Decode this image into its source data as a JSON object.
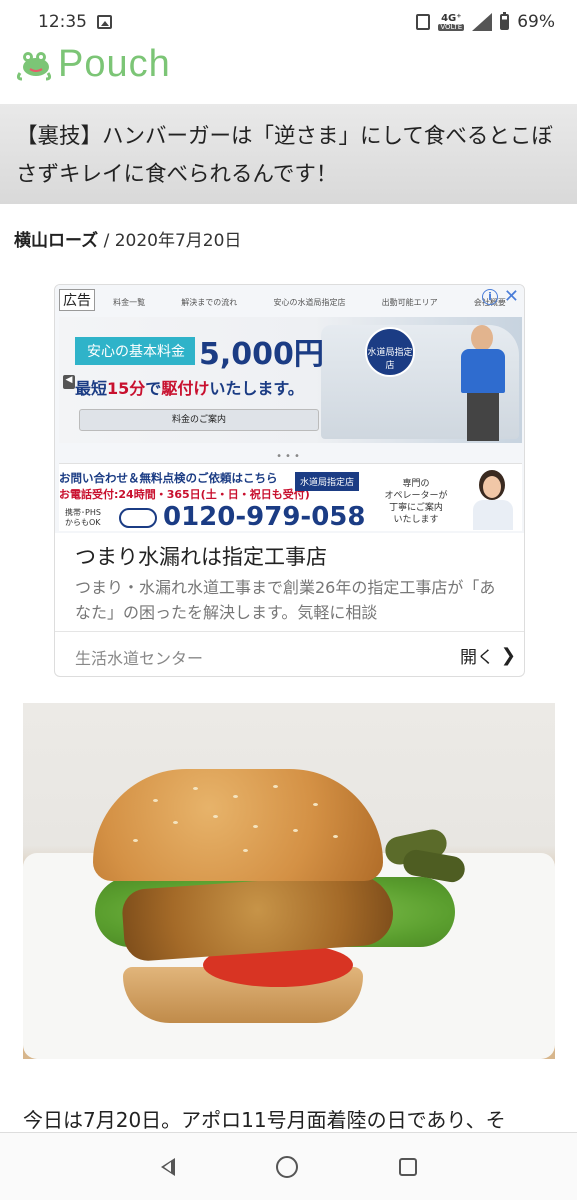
{
  "status_bar": {
    "time": "12:35",
    "network": "4G⁺",
    "volte": "VOLTE",
    "battery": "69%"
  },
  "site": {
    "logo_text": "Pouch",
    "brand_color": "#7cc576"
  },
  "article": {
    "title": "【裏技】ハンバーガーは「逆さま」にして食べるとこぼさずキレイに食べられるんです！",
    "author": "横山ローズ",
    "separator": "/",
    "date": "2020年7月20日",
    "body_first_line": "今日は7月20日。アポロ11号月面着陸の日であり、そ"
  },
  "ad": {
    "badge": "広告",
    "info": "i",
    "close": "✕",
    "nav_items": [
      "料金一覧",
      "解決までの流れ",
      "安心の水道局指定店",
      "出動可能エリア",
      "会社概要"
    ],
    "hero": {
      "basic_fee_label": "安心の基本料金",
      "price": "5,000円",
      "arrival_prefix": "最短",
      "arrival_minutes": "15分",
      "arrival_mid": "で",
      "arrival_highlight": "駆付け",
      "arrival_suffix": "いたします。",
      "button": "料金のご案内",
      "badge": "水道局指定店"
    },
    "dots": "•••",
    "contact": {
      "line1": "お問い合わせ＆無料点検のご依頼はこちら",
      "line2": "お電話受付:24時間・365日(土・日・祝日も受付)",
      "tag": "水道局指定店",
      "mobile_note_1": "携帯･PHS",
      "mobile_note_2": "からもOK",
      "phone": "0120-979-058",
      "bubble_1": "専門の",
      "bubble_2": "オペレーターが",
      "bubble_3": "丁寧にご案内",
      "bubble_4": "いたします"
    },
    "headline": "つまり水漏れは指定工事店",
    "description": "つまり・水漏れ水道工事まで創業26年の指定工事店が「あなた」の困ったを解決します。気軽に相談",
    "advertiser": "生活水道センター",
    "open_label": "開く"
  },
  "icons": {
    "nav_back": "back-icon",
    "nav_home": "home-icon",
    "nav_recents": "recents-icon"
  }
}
